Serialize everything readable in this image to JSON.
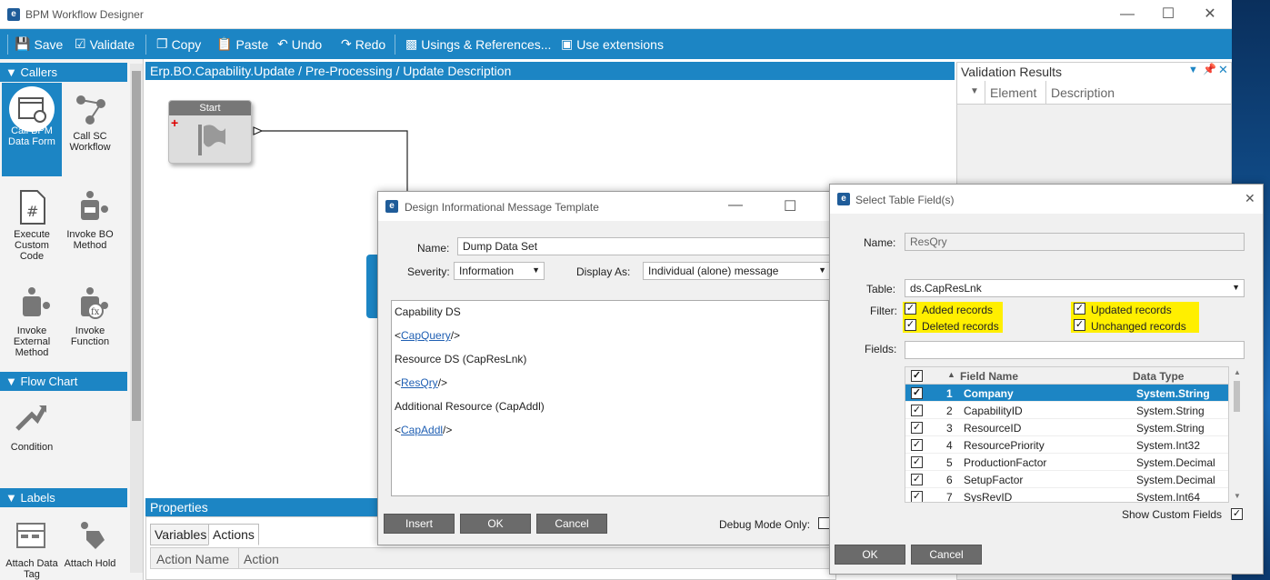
{
  "window": {
    "title": "BPM Workflow Designer",
    "logo": "e"
  },
  "toolbar": {
    "save": "Save",
    "validate": "Validate",
    "copy": "Copy",
    "paste": "Paste",
    "undo": "Undo",
    "redo": "Redo",
    "usings": "Usings & References...",
    "extensions": "Use extensions"
  },
  "palette": {
    "callers": "Callers",
    "items": [
      "Call BPM Data Form",
      "Call SC Workflow",
      "Execute Custom Code",
      "Invoke BO Method",
      "Invoke External Method",
      "Invoke Function"
    ],
    "flowchart": "Flow Chart",
    "condition": "Condition",
    "labels": "Labels",
    "label_items": [
      "Attach Data Tag",
      "Attach Hold"
    ]
  },
  "breadcrumb": "Erp.BO.Capability.Update / Pre-Processing / Update Description",
  "start_node": {
    "label": "Start"
  },
  "properties": {
    "title": "Properties",
    "tabs": [
      "Variables",
      "Actions"
    ],
    "columns": [
      "Action Name",
      "Action"
    ]
  },
  "validation": {
    "title": "Validation Results",
    "columns": [
      "Element",
      "Description"
    ]
  },
  "dialog1": {
    "title": "Design Informational Message Template",
    "name_label": "Name:",
    "name_value": "Dump Data Set",
    "severity_label": "Severity:",
    "severity_value": "Information",
    "display_label": "Display As:",
    "display_value": "Individual (alone) message",
    "lines": [
      {
        "text": "Capability DS"
      },
      {
        "pre": "<",
        "link": "CapQuery",
        "post": "/>"
      },
      {
        "text": "Resource DS (CapResLnk)"
      },
      {
        "pre": "<",
        "link": "ResQry",
        "post": "/>"
      },
      {
        "text": "Additional Resource (CapAddl)"
      },
      {
        "pre": "<",
        "link": "CapAddl",
        "post": "/>"
      }
    ],
    "insert": "Insert",
    "ok": "OK",
    "cancel": "Cancel",
    "debug": "Debug Mode Only:"
  },
  "dialog2": {
    "title": "Select Table Field(s)",
    "name_label": "Name:",
    "name_value": "ResQry",
    "table_label": "Table:",
    "table_value": "ds.CapResLnk",
    "filter_label": "Filter:",
    "filters": [
      "Added records",
      "Updated records",
      "Deleted records",
      "Unchanged records"
    ],
    "fields_label": "Fields:",
    "grid_cols": [
      "Field Name",
      "Data Type"
    ],
    "rows": [
      {
        "n": "1",
        "field": "Company",
        "type": "System.String"
      },
      {
        "n": "2",
        "field": "CapabilityID",
        "type": "System.String"
      },
      {
        "n": "3",
        "field": "ResourceID",
        "type": "System.String"
      },
      {
        "n": "4",
        "field": "ResourcePriority",
        "type": "System.Int32"
      },
      {
        "n": "5",
        "field": "ProductionFactor",
        "type": "System.Decimal"
      },
      {
        "n": "6",
        "field": "SetupFactor",
        "type": "System.Decimal"
      },
      {
        "n": "7",
        "field": "SysRevID",
        "type": "System.Int64"
      }
    ],
    "show_custom": "Show Custom Fields",
    "ok": "OK",
    "cancel": "Cancel"
  },
  "colors": {
    "accent": "#1c85c4",
    "highlight": "#ffef00",
    "selected": "#1c85c4"
  }
}
